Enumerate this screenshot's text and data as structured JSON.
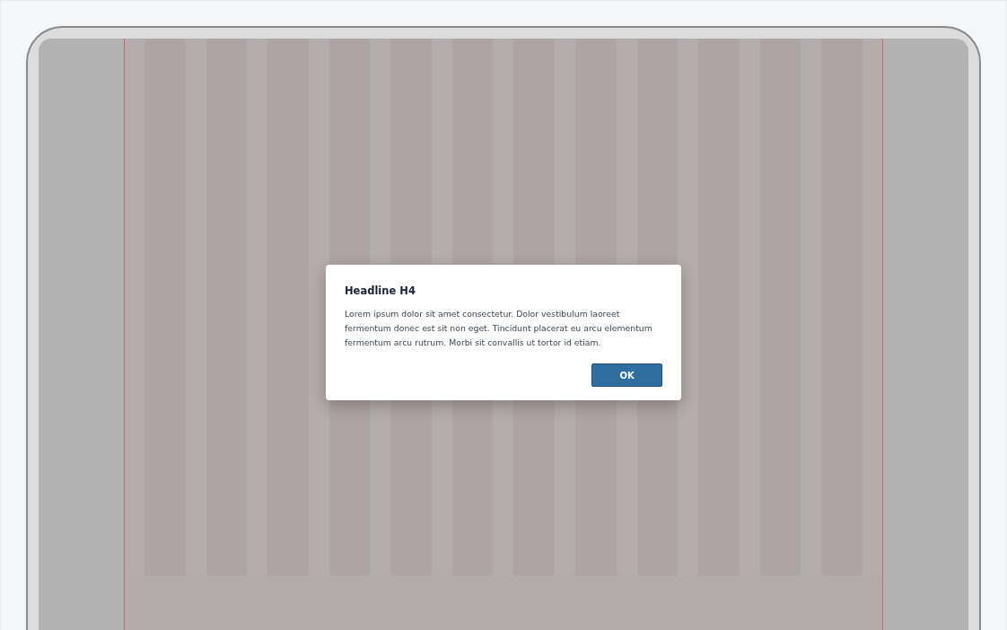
{
  "dialog": {
    "title": "Headline H4",
    "body": "Lorem ipsum dolor sit amet consectetur. Dolor vestibulum laoreet fermentum donec est sit non eget. Tincidunt placerat eu arcu elementum fermentum arcu rutrum. Morbi sit convallis ut tortor id etiam.",
    "buttons": [
      {
        "label": "OK",
        "kind": "primary"
      }
    ]
  }
}
